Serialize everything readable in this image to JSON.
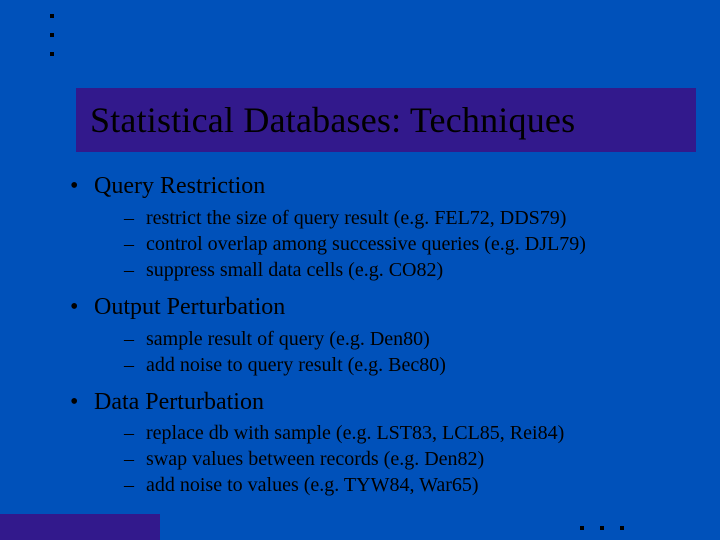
{
  "title": "Statistical Databases: Techniques",
  "bullets": [
    {
      "label": "Query Restriction",
      "subs": [
        "restrict the size of query result (e.g. FEL72, DDS79)",
        "control overlap among successive queries (e.g. DJL79)",
        "suppress small data cells (e.g. CO82)"
      ]
    },
    {
      "label": "Output Perturbation",
      "subs": [
        "sample result of query (e.g. Den80)",
        "add noise to query result (e.g. Bec80)"
      ]
    },
    {
      "label": "Data Perturbation",
      "subs": [
        "replace db with sample (e.g. LST83, LCL85, Rei84)",
        "swap values between records (e.g. Den82)",
        "add noise to values (e.g. TYW84, War65)"
      ]
    }
  ]
}
